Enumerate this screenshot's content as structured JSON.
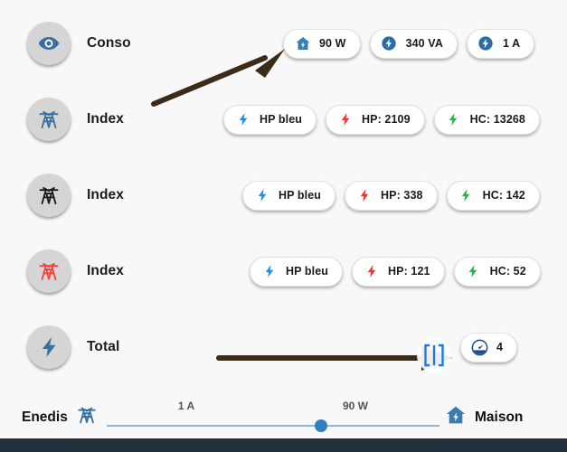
{
  "app": {
    "background_color": "#f8f8f8",
    "footer_color": "#23313d"
  },
  "rows": [
    {
      "label": "Conso",
      "icon": "eye-icon",
      "icon_color": "#3d6f9e",
      "chips": [
        {
          "label": "90 W",
          "icon": "house-bolt-icon",
          "icon_color": "#3d7cb0"
        },
        {
          "label": "340 VA",
          "icon": "bolt-circle-icon",
          "icon_color": "#2b6ca8"
        },
        {
          "label": "1 A",
          "icon": "bolt-circle-icon",
          "icon_color": "#2b6ca8"
        }
      ]
    },
    {
      "label": "Index",
      "icon": "pylon-icon",
      "icon_color": "#3d6f9e",
      "chips": [
        {
          "label": "HP bleu",
          "icon": "bolt-icon",
          "icon_color": "#1f8fe8"
        },
        {
          "label": "HP: 2109",
          "icon": "bolt-icon",
          "icon_color": "#e8392a"
        },
        {
          "label": "HC: 13268",
          "icon": "bolt-icon",
          "icon_color": "#2fb14a"
        }
      ]
    },
    {
      "label": "Index",
      "icon": "pylon-icon",
      "icon_color": "#1a1a1a",
      "chips": [
        {
          "label": "HP bleu",
          "icon": "bolt-icon",
          "icon_color": "#1f8fe8"
        },
        {
          "label": "HP: 338",
          "icon": "bolt-icon",
          "icon_color": "#e8392a"
        },
        {
          "label": "HC: 142",
          "icon": "bolt-icon",
          "icon_color": "#2fb14a"
        }
      ]
    },
    {
      "label": "Index",
      "icon": "pylon-icon",
      "icon_color": "#f0463a",
      "chips": [
        {
          "label": "HP bleu",
          "icon": "bolt-icon",
          "icon_color": "#1f8fe8"
        },
        {
          "label": "HP: 121",
          "icon": "bolt-icon",
          "icon_color": "#e8392a"
        },
        {
          "label": "HC: 52",
          "icon": "bolt-icon",
          "icon_color": "#2fb14a"
        }
      ]
    },
    {
      "label": "Total",
      "icon": "bolt-icon",
      "icon_color": "#3d6f9e",
      "chips": [
        {
          "label": "4",
          "icon": "gauge-icon",
          "icon_color": "#1e4b87"
        }
      ]
    }
  ],
  "flow": {
    "source_label": "Enedis",
    "source_icon": "pylon-icon",
    "target_label": "Maison",
    "target_icon": "house-bolt-icon",
    "left_value": "1 A",
    "right_value": "90 W",
    "track_color": "#8fb6d6",
    "knob_color": "#2f7fc1"
  },
  "annotations": {
    "arrow_color": "#3d2b1a",
    "cursor": "text-select-cursor"
  }
}
